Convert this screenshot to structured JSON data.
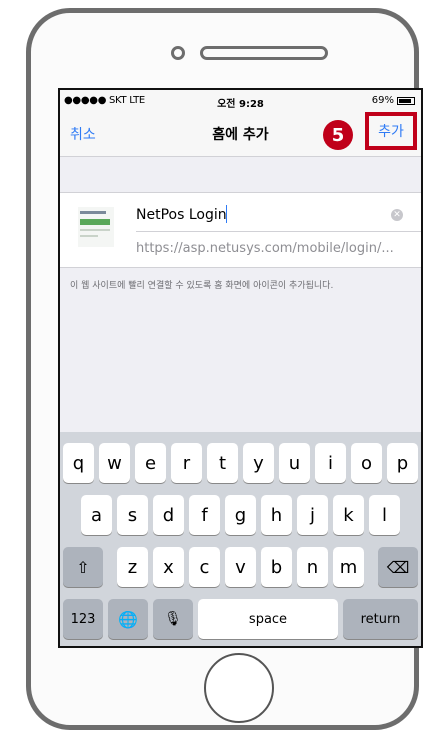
{
  "status_bar": {
    "carrier": "●●●●● SKT  LTE",
    "time": "오전 9:28",
    "battery": "69%"
  },
  "nav": {
    "cancel": "취소",
    "title": "홈에 추가",
    "add": "추가",
    "step_number": "5"
  },
  "bookmark": {
    "title_value": "NetPos Login",
    "url": "https://asp.netusys.com/mobile/login/..."
  },
  "hint_text": "이 웹 사이트에 빨리 연결할 수 있도록 홈 화면에 아이콘이 추가됩니다.",
  "keyboard": {
    "row1": [
      "q",
      "w",
      "e",
      "r",
      "t",
      "y",
      "u",
      "i",
      "o",
      "p"
    ],
    "row2": [
      "a",
      "s",
      "d",
      "f",
      "g",
      "h",
      "j",
      "k",
      "l"
    ],
    "row3": [
      "z",
      "x",
      "c",
      "v",
      "b",
      "n",
      "m"
    ],
    "shift": "⇧",
    "backspace": "⌫",
    "numbers": "123",
    "globe": "🌐",
    "mic": "🎙",
    "space": "space",
    "return": "return"
  },
  "colors": {
    "accent": "#2f7bf5",
    "highlight": "#c0001a"
  }
}
